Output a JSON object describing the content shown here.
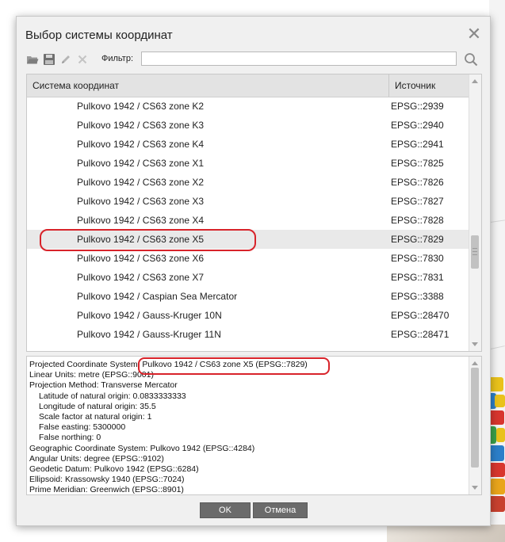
{
  "dialog": {
    "title": "Выбор системы координат",
    "close_icon": "close-icon"
  },
  "toolbar": {
    "icons": [
      "folder-open-icon",
      "save-icon",
      "edit-icon",
      "delete-icon"
    ],
    "filter_label": "Фильтр:",
    "filter_value": "",
    "search_icon": "search-icon"
  },
  "table": {
    "columns": [
      "Система координат",
      "Источник"
    ],
    "rows": [
      {
        "name": "Pulkovo 1942 / CS63 zone K2",
        "source": "EPSG::2939"
      },
      {
        "name": "Pulkovo 1942 / CS63 zone K3",
        "source": "EPSG::2940"
      },
      {
        "name": "Pulkovo 1942 / CS63 zone K4",
        "source": "EPSG::2941"
      },
      {
        "name": "Pulkovo 1942 / CS63 zone X1",
        "source": "EPSG::7825"
      },
      {
        "name": "Pulkovo 1942 / CS63 zone X2",
        "source": "EPSG::7826"
      },
      {
        "name": "Pulkovo 1942 / CS63 zone X3",
        "source": "EPSG::7827"
      },
      {
        "name": "Pulkovo 1942 / CS63 zone X4",
        "source": "EPSG::7828"
      },
      {
        "name": "Pulkovo 1942 / CS63 zone X5",
        "source": "EPSG::7829",
        "selected": true
      },
      {
        "name": "Pulkovo 1942 / CS63 zone X6",
        "source": "EPSG::7830"
      },
      {
        "name": "Pulkovo 1942 / CS63 zone X7",
        "source": "EPSG::7831"
      },
      {
        "name": "Pulkovo 1942 / Caspian Sea Mercator",
        "source": "EPSG::3388"
      },
      {
        "name": "Pulkovo 1942 / Gauss-Kruger 10N",
        "source": "EPSG::28470"
      },
      {
        "name": "Pulkovo 1942 / Gauss-Kruger 11N",
        "source": "EPSG::28471"
      }
    ]
  },
  "info": {
    "lines": [
      {
        "text": "Projected Coordinate System: Pulkovo 1942 / CS63 zone X5 (EPSG::7829)",
        "indent": false
      },
      {
        "text": "Linear Units: metre (EPSG::9001)",
        "indent": false
      },
      {
        "text": "Projection Method: Transverse Mercator",
        "indent": false
      },
      {
        "text": "Latitude of natural origin: 0.0833333333",
        "indent": true
      },
      {
        "text": "Longitude of natural origin: 35.5",
        "indent": true
      },
      {
        "text": "Scale factor at natural origin: 1",
        "indent": true
      },
      {
        "text": "False easting: 5300000",
        "indent": true
      },
      {
        "text": "False northing: 0",
        "indent": true
      },
      {
        "text": "Geographic Coordinate System: Pulkovo 1942 (EPSG::4284)",
        "indent": false
      },
      {
        "text": "Angular Units: degree (EPSG::9102)",
        "indent": false
      },
      {
        "text": "Geodetic Datum: Pulkovo 1942 (EPSG::6284)",
        "indent": false
      },
      {
        "text": "Ellipsoid: Krassowsky 1940 (EPSG::7024)",
        "indent": false
      },
      {
        "text": "Prime Meridian: Greenwich (EPSG::8901)",
        "indent": false
      }
    ]
  },
  "buttons": {
    "ok": "OK",
    "cancel": "Отмена"
  },
  "colors": {
    "highlight": "#d8232a",
    "button": "#6b6b6b",
    "selected_row": "#e9e9e9"
  }
}
